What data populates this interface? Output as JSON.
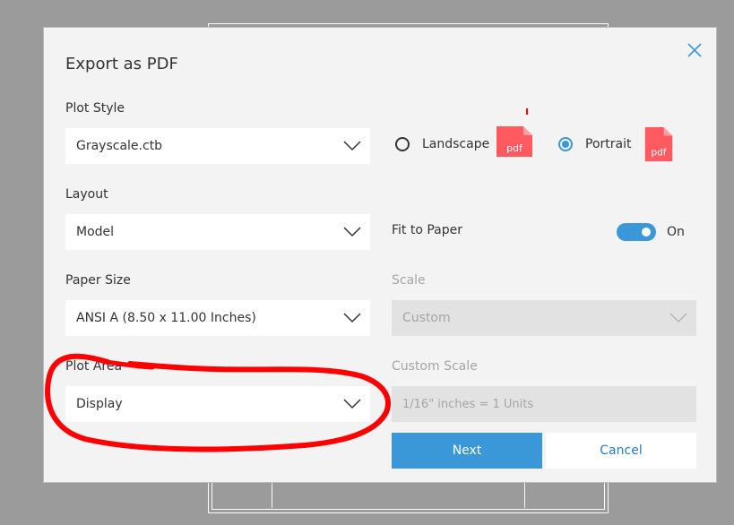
{
  "dialog": {
    "title": "Export as PDF",
    "close_icon": "close-icon"
  },
  "plot_style": {
    "label": "Plot Style",
    "value": "Grayscale.ctb"
  },
  "orientation": {
    "options": [
      {
        "label": "Landscape",
        "checked": false,
        "icon": "pdf-file-icon",
        "icon_text": "pdf"
      },
      {
        "label": "Portrait",
        "checked": true,
        "icon": "pdf-file-icon",
        "icon_text": "pdf"
      }
    ]
  },
  "layout": {
    "label": "Layout",
    "value": "Model"
  },
  "fit_to_paper": {
    "label": "Fit to Paper",
    "state_label": "On",
    "enabled": true
  },
  "paper_size": {
    "label": "Paper Size",
    "value": "ANSI A (8.50 x 11.00 Inches)"
  },
  "scale": {
    "label": "Scale",
    "value": "Custom",
    "disabled": true
  },
  "plot_area": {
    "label": "Plot Area",
    "value": "Display"
  },
  "custom_scale": {
    "label": "Custom Scale",
    "placeholder": "1/16\" inches = 1 Units",
    "disabled": true
  },
  "buttons": {
    "next": "Next",
    "cancel": "Cancel"
  },
  "colors": {
    "accent": "#3a98d8",
    "dialog_bg": "#f3f3f3",
    "backdrop": "#9b9b9b",
    "pdf_icon": "#ff5a5f",
    "annotation": "#ff0000"
  }
}
